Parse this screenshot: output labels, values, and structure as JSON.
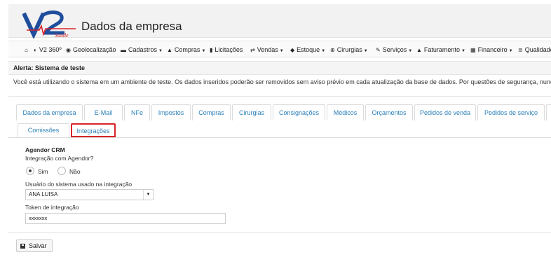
{
  "header": {
    "title": "Dados da empresa",
    "logo_text": "V2 Saúde"
  },
  "navbar": {
    "items": [
      {
        "label": "",
        "icon": "home-icon",
        "glyph": "⌂"
      },
      {
        "label": "V2 360º",
        "icon": "globe-icon",
        "glyph": "◐"
      },
      {
        "label": "Geolocalização",
        "icon": "target-icon",
        "glyph": "◉"
      },
      {
        "label": "Cadastros",
        "icon": "truck-icon",
        "glyph": "▬",
        "dropdown": true
      },
      {
        "label": "Compras",
        "icon": "shop-icon",
        "glyph": "▲",
        "dropdown": true
      },
      {
        "label": "Licitações",
        "icon": "document-icon",
        "glyph": "▮"
      },
      {
        "label": "Vendas",
        "icon": "exchange-icon",
        "glyph": "⇄",
        "dropdown": true
      },
      {
        "label": "Estoque",
        "icon": "tag-icon",
        "glyph": "◆",
        "dropdown": true
      },
      {
        "label": "Cirurgias",
        "icon": "plus-circle-icon",
        "glyph": "⊕",
        "dropdown": true
      },
      {
        "label": "Serviços",
        "icon": "wrench-icon",
        "glyph": "✎",
        "dropdown": true
      },
      {
        "label": "Faturamento",
        "icon": "bank-icon",
        "glyph": "▲",
        "dropdown": true
      },
      {
        "label": "Financeiro",
        "icon": "calculator-icon",
        "glyph": "▦",
        "dropdown": true
      },
      {
        "label": "Qualidade",
        "icon": "list-icon",
        "glyph": "≣",
        "dropdown": true
      }
    ]
  },
  "alert": {
    "title": "Alerta: Sistema de teste",
    "text": "Você está utilizando o sistema em um ambiente de teste. Os dados inseridos poderão ser removidos sem aviso prévio em cada atualização da base de dados. Por questões de segurança, nunca"
  },
  "tabs": {
    "row1": [
      "Dados da empresa",
      "E-Mail",
      "NFe",
      "Impostos",
      "Compras",
      "Cirurgias",
      "Consignações",
      "Médicos",
      "Orçamentos",
      "Pedidos de venda",
      "Pedidos de serviço",
      "C"
    ],
    "row2": [
      "Comissões",
      "Integrações"
    ],
    "active": "Integrações"
  },
  "form": {
    "section_title": "Agendor CRM",
    "question_label": "Integração com Agendor?",
    "option_yes": "Sim",
    "option_no": "Não",
    "selected_option": "Sim",
    "user_label": "Usuário do sistema usado na integração",
    "user_value": "ANA LUISA",
    "token_label": "Token de integração",
    "token_value": "xxxxxxx"
  },
  "actions": {
    "save_label": "Salvar"
  }
}
